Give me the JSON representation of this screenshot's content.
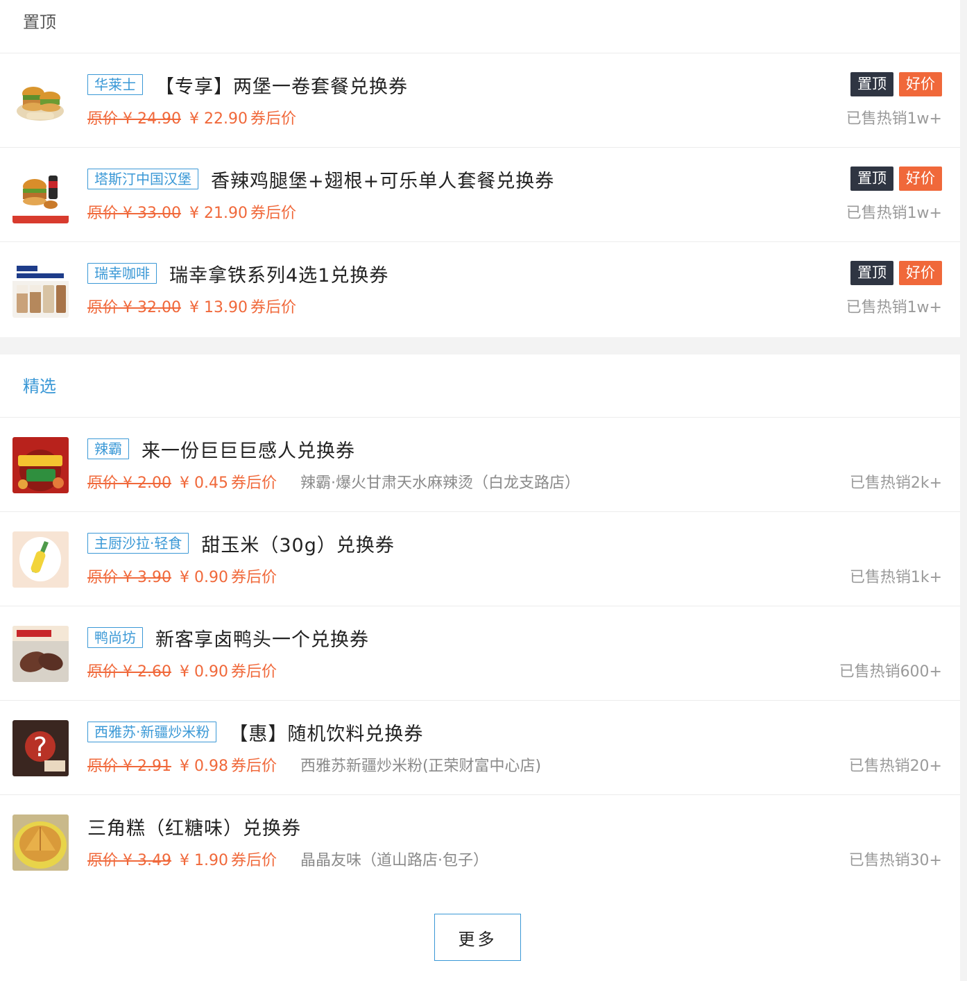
{
  "sections": {
    "top": {
      "title": "置顶",
      "items": [
        {
          "shop": "华莱士",
          "title": "【专享】两堡一卷套餐兑换券",
          "original_price": "原价 ¥ 24.90",
          "price": "¥ 22.90",
          "price_note": "券后价",
          "sold": "已售热销1w+",
          "badge_pin": "置顶",
          "badge_deal": "好价",
          "thumb_icon": "burger-combo-image"
        },
        {
          "shop": "塔斯汀中国汉堡",
          "title": "香辣鸡腿堡+翅根+可乐单人套餐兑换券",
          "original_price": "原价 ¥ 33.00",
          "price": "¥ 21.90",
          "price_note": "券后价",
          "sold": "已售热销1w+",
          "badge_pin": "置顶",
          "badge_deal": "好价",
          "thumb_icon": "burger-cola-image"
        },
        {
          "shop": "瑞幸咖啡",
          "title": "瑞幸拿铁系列4选1兑换券",
          "original_price": "原价 ¥ 32.00",
          "price": "¥ 13.90",
          "price_note": "券后价",
          "sold": "已售热销1w+",
          "badge_pin": "置顶",
          "badge_deal": "好价",
          "thumb_icon": "latte-image"
        }
      ]
    },
    "featured": {
      "title": "精选",
      "items": [
        {
          "shop": "辣霸",
          "title": "来一份巨巨巨感人兑换券",
          "original_price": "原价 ¥ 2.00",
          "price": "¥ 0.45",
          "price_note": "券后价",
          "store": "辣霸·爆火甘肃天水麻辣烫（白龙支路店）",
          "sold": "已售热销2k+",
          "thumb_icon": "spicy-pot-image"
        },
        {
          "shop": "主厨沙拉·轻食",
          "title": "甜玉米（30g）兑换券",
          "original_price": "原价 ¥ 3.90",
          "price": "¥ 0.90",
          "price_note": "券后价",
          "store": "",
          "sold": "已售热销1k+",
          "thumb_icon": "corn-image"
        },
        {
          "shop": "鸭尚坊",
          "title": "新客享卤鸭头一个兑换券",
          "original_price": "原价 ¥ 2.60",
          "price": "¥ 0.90",
          "price_note": "券后价",
          "store": "",
          "sold": "已售热销600+",
          "thumb_icon": "duck-head-image"
        },
        {
          "shop": "西雅苏·新疆炒米粉",
          "title": "【惠】随机饮料兑换券",
          "original_price": "原价 ¥ 2.91",
          "price": "¥ 0.98",
          "price_note": "券后价",
          "store": "西雅苏新疆炒米粉(正荣财富中心店)",
          "sold": "已售热销20+",
          "thumb_icon": "mystery-drink-image"
        },
        {
          "shop": "",
          "title": "三角糕（红糖味）兑换券",
          "original_price": "原价 ¥ 3.49",
          "price": "¥ 1.90",
          "price_note": "券后价",
          "store": "晶晶友味（道山路店·包子）",
          "sold": "已售热销30+",
          "thumb_icon": "triangle-cake-image"
        }
      ],
      "more_label": "更多"
    }
  },
  "colors": {
    "accent_blue": "#3a98d6",
    "price_orange": "#f0683a",
    "badge_dark": "#2f3542"
  }
}
